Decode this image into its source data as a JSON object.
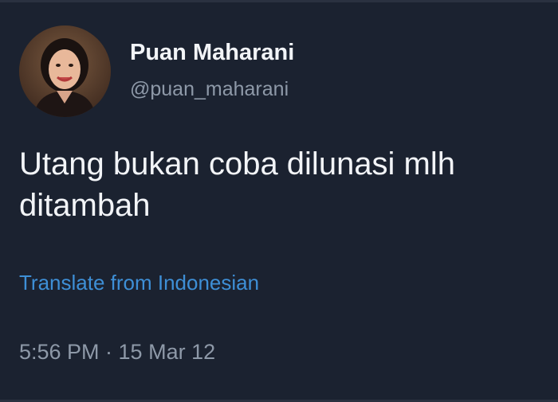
{
  "user": {
    "display_name": "Puan Maharani",
    "handle": "@puan_maharani"
  },
  "tweet": {
    "text": "Utang bukan coba dilunasi mlh ditambah",
    "translate_label": "Translate from Indonesian",
    "timestamp": "5:56 PM · 15 Mar 12"
  },
  "colors": {
    "background": "#1b2230",
    "primary_text": "#f2f4f7",
    "secondary_text": "#8e99a8",
    "link": "#3e8fd6"
  }
}
